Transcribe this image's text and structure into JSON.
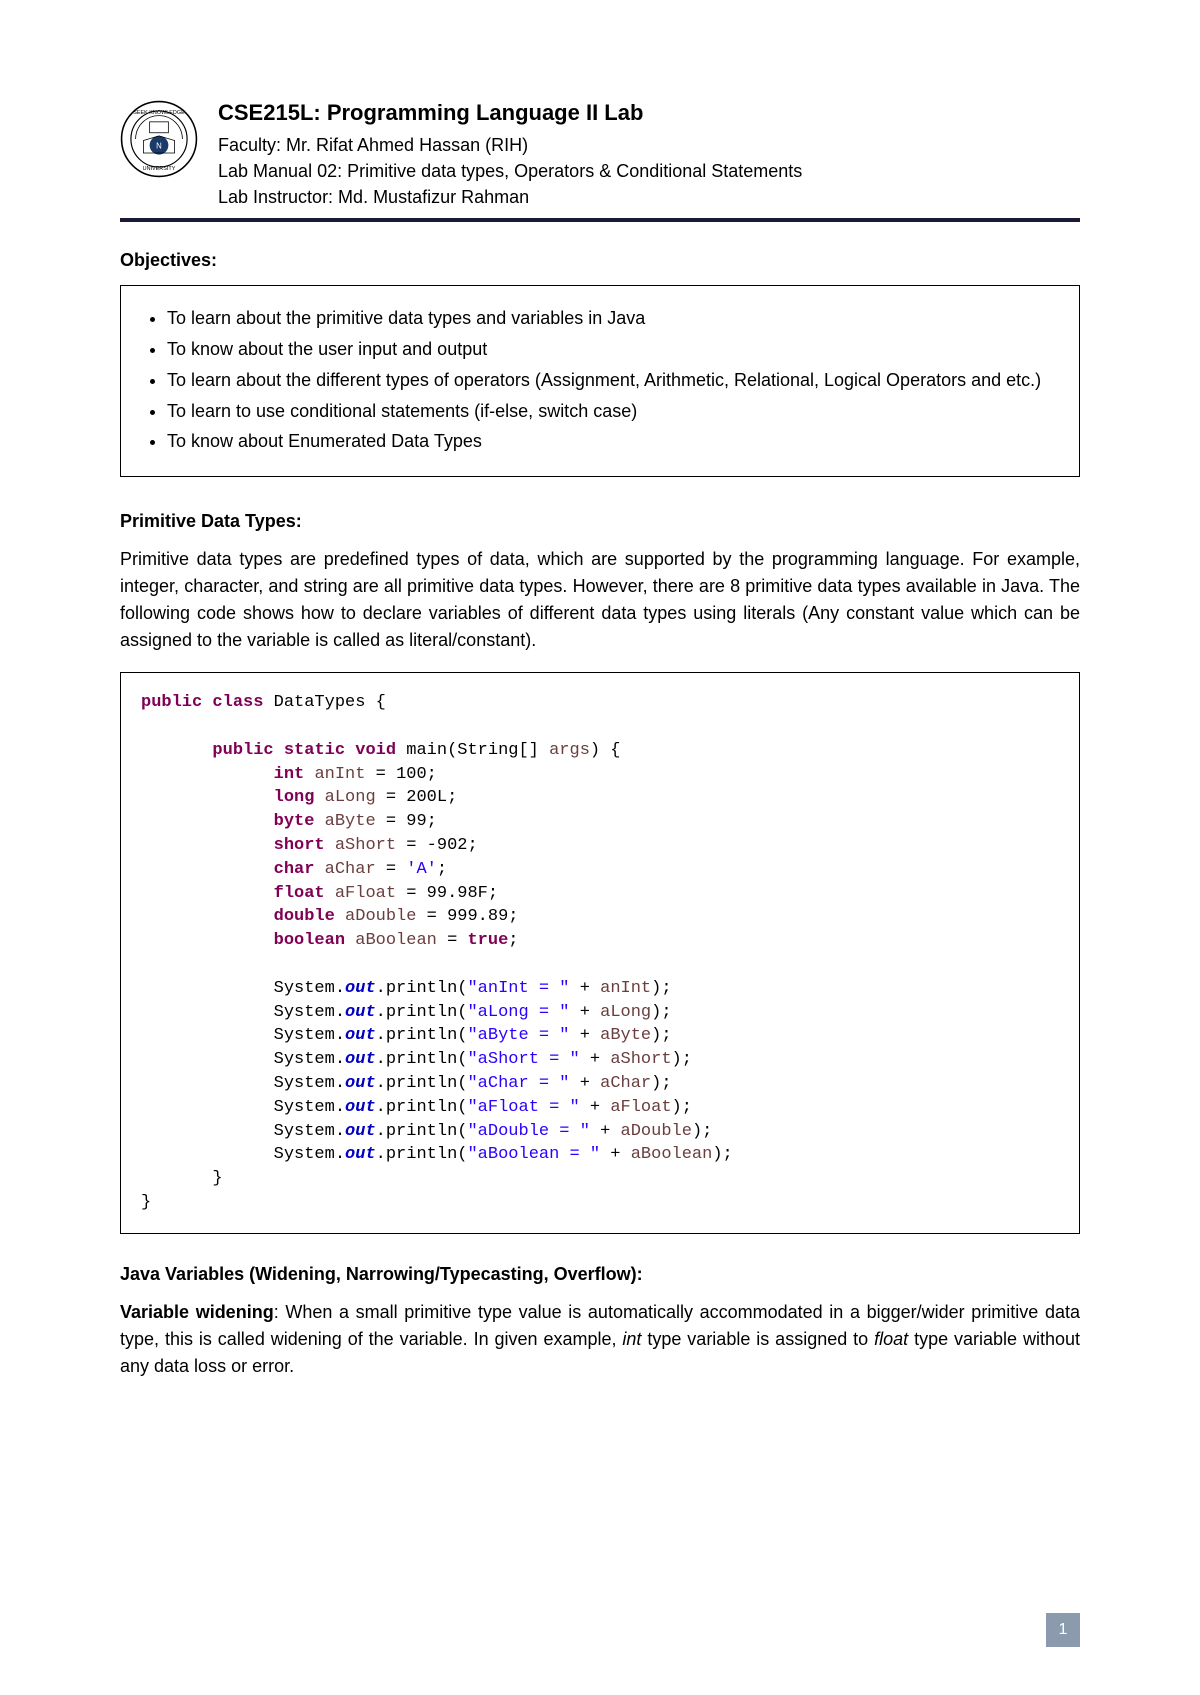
{
  "header": {
    "course_title": "CSE215L: Programming Language II Lab",
    "faculty": "Faculty: Mr. Rifat Ahmed Hassan (RIH)",
    "manual": "Lab Manual 02: Primitive data types, Operators & Conditional Statements",
    "instructor": "Lab Instructor: Md. Mustafizur Rahman"
  },
  "sections": {
    "objectives_title": "Objectives:",
    "objectives": [
      "To learn about the primitive data types and variables in Java",
      "To know about the user input and output",
      "To learn about the different types of operators (Assignment, Arithmetic, Relational, Logical Operators and etc.)",
      "To learn to use conditional statements (if-else, switch case)",
      "To know about Enumerated Data Types"
    ],
    "primitive_title": "Primitive Data Types:",
    "primitive_para": "Primitive data types are predefined types of data, which are supported by the programming language. For example, integer, character, and string are all primitive data types. However, there are 8 primitive data types available in Java. The following code shows how to declare variables of different data types using literals (Any constant value which can be assigned to the variable is called as literal/constant).",
    "variables_title": "Java Variables (Widening, Narrowing/Typecasting, Overflow):",
    "widening_label": "Variable widening",
    "widening_text_1": ": When a small primitive type value is automatically accommodated in a bigger/wider primitive data type, this is called widening of the variable. In given example, ",
    "widening_ital_1": "int",
    "widening_text_2": " type variable is assigned to ",
    "widening_ital_2": "float",
    "widening_text_3": " type variable without any data loss or error."
  },
  "code": {
    "class_decl_kw1": "public class",
    "class_name": " DataTypes {",
    "method_kw": "public static void",
    "method_sig_1": " main(String[] ",
    "method_arg": "args",
    "method_sig_2": ") {",
    "decls": [
      {
        "type": "int",
        "name": "anInt",
        "val": "100"
      },
      {
        "type": "long",
        "name": "aLong",
        "val": "200L"
      },
      {
        "type": "byte",
        "name": "aByte",
        "val": "99"
      },
      {
        "type": "short",
        "name": "aShort",
        "val": "-902"
      },
      {
        "type": "char",
        "name": "aChar",
        "val": "'A'"
      },
      {
        "type": "float",
        "name": "aFloat",
        "val": "99.98F"
      },
      {
        "type": "double",
        "name": "aDouble",
        "val": "999.89"
      }
    ],
    "bool_type": "boolean",
    "bool_name": "aBoolean",
    "bool_val": "true",
    "prints": [
      {
        "str": "\"anInt = \"",
        "var": "anInt"
      },
      {
        "str": "\"aLong = \"",
        "var": "aLong"
      },
      {
        "str": "\"aByte = \"",
        "var": "aByte"
      },
      {
        "str": "\"aShort = \"",
        "var": "aShort"
      },
      {
        "str": "\"aChar = \"",
        "var": "aChar"
      },
      {
        "str": "\"aFloat = \"",
        "var": "aFloat"
      },
      {
        "str": "\"aDouble = \"",
        "var": "aDouble"
      },
      {
        "str": "\"aBoolean = \"",
        "var": "aBoolean"
      }
    ],
    "sys": "System.",
    "out": "out",
    "println": ".println("
  },
  "page_number": "1"
}
